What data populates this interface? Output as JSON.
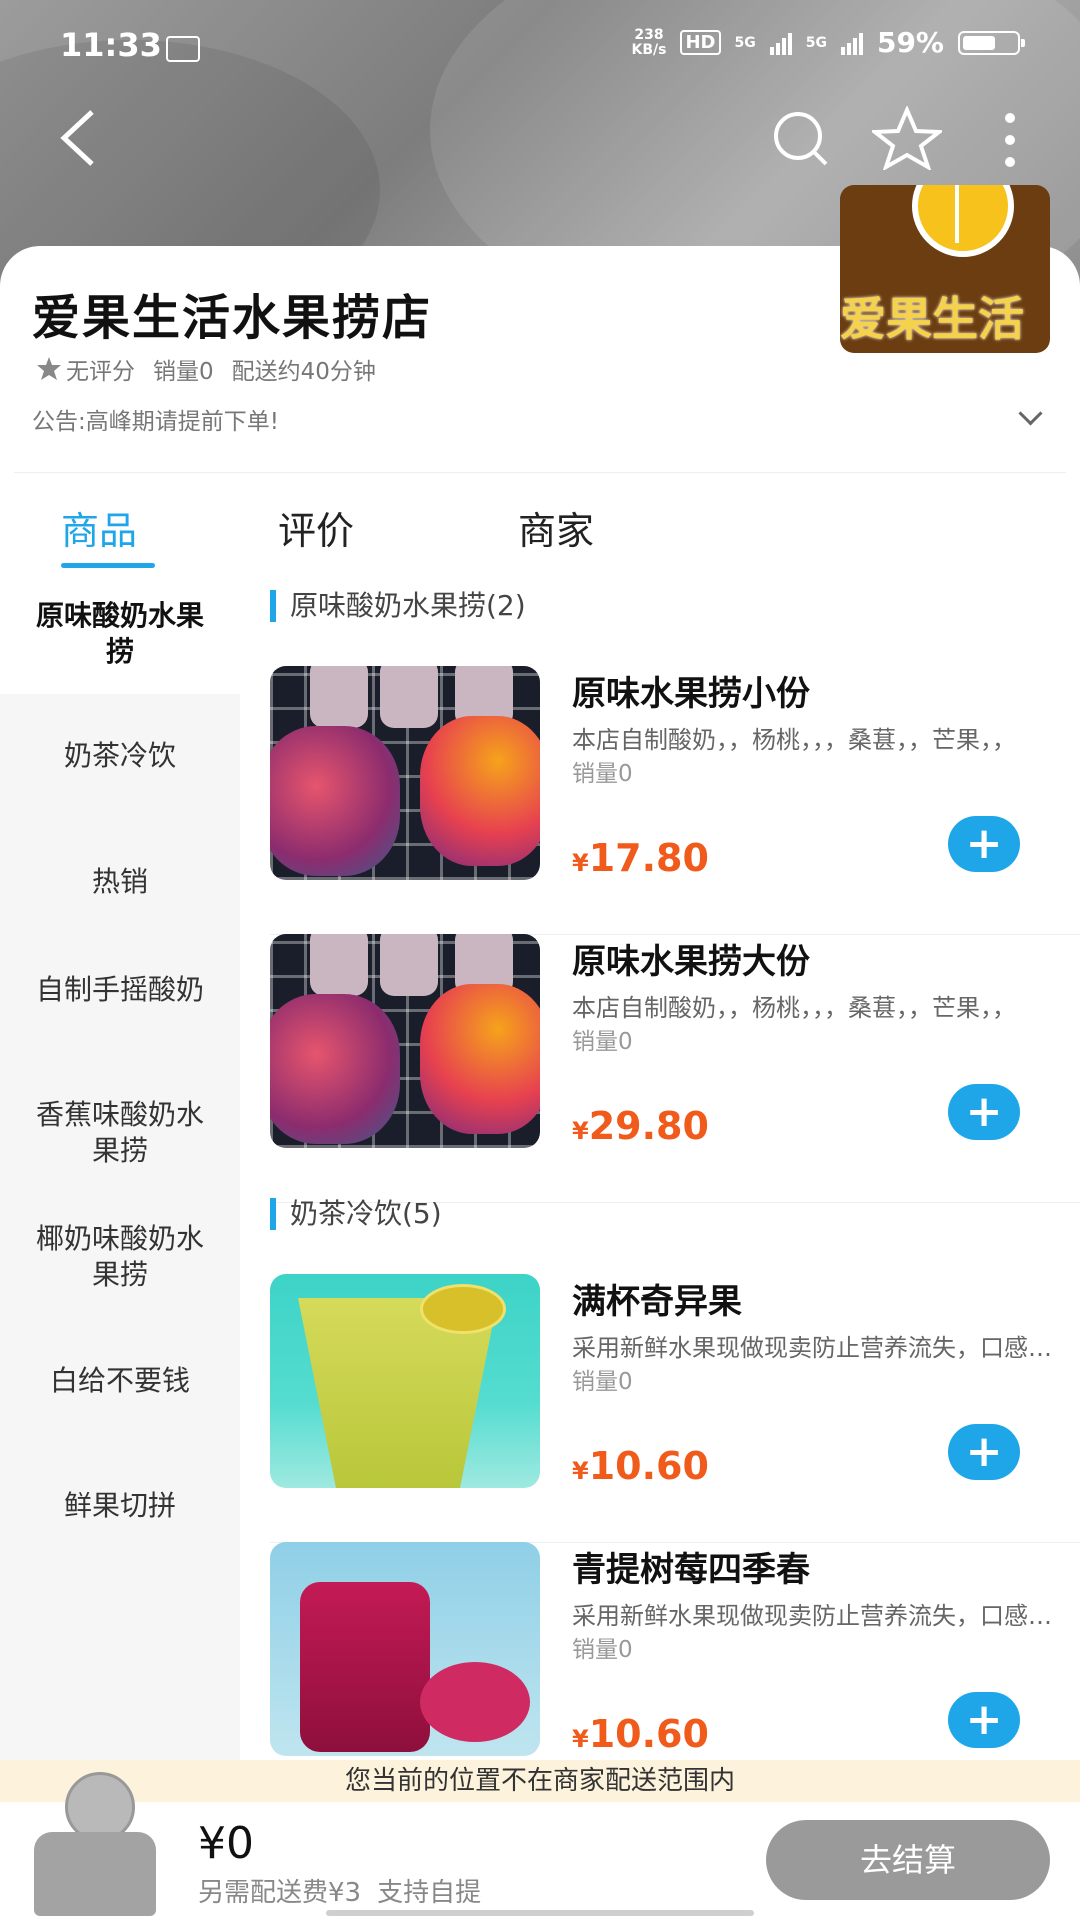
{
  "status_bar": {
    "time": "11:33",
    "speed": "238",
    "speed_unit": "KB/s",
    "hd": "HD",
    "net1": "5G",
    "net2": "5G",
    "battery": "59%",
    "battery_level": 0.59
  },
  "nav": {
    "back_icon": "back-arrow-icon",
    "search_icon": "search-icon",
    "favorite_icon": "star-icon",
    "more_icon": "more-vertical-icon"
  },
  "shop": {
    "logo_text": "爱果生活",
    "name": "爱果生活水果捞店",
    "rating": "无评分",
    "sales": "销量0",
    "delivery": "配送约40分钟",
    "notice": "公告:高峰期请提前下单!"
  },
  "tabs": [
    {
      "label": "商品"
    },
    {
      "label": "评价"
    },
    {
      "label": "商家"
    }
  ],
  "sidebar": [
    {
      "label": "原味酸奶水果捞"
    },
    {
      "label": "奶茶冷饮"
    },
    {
      "label": "热销"
    },
    {
      "label": "自制手摇酸奶"
    },
    {
      "label": "香蕉味酸奶水果捞"
    },
    {
      "label": "椰奶味酸奶水果捞"
    },
    {
      "label": "白给不要钱"
    },
    {
      "label": "鲜果切拼"
    }
  ],
  "sections": [
    {
      "title": "原味酸奶水果捞(2)"
    },
    {
      "title": "奶茶冷饮(5)"
    }
  ],
  "products": [
    {
      "name": "原味水果捞小份",
      "desc": "本店自制酸奶，，杨桃，，，桑葚，，芒果，，",
      "sales": "销量0",
      "currency": "¥",
      "price": "17.80"
    },
    {
      "name": "原味水果捞大份",
      "desc": "本店自制酸奶，，杨桃，，，桑葚，，芒果，，",
      "sales": "销量0",
      "currency": "¥",
      "price": "29.80"
    },
    {
      "name": "满杯奇异果",
      "desc": "采用新鲜水果现做现卖防止营养流失，口感清爽",
      "sales": "销量0",
      "currency": "¥",
      "price": "10.60"
    },
    {
      "name": "青提树莓四季春",
      "desc": "采用新鲜水果现做现卖防止营养流失，口感清爽",
      "sales": "销量0",
      "currency": "¥",
      "price": "10.60"
    }
  ],
  "add_label": "+",
  "delivery_notice": "您当前的位置不在商家配送范围内",
  "cart": {
    "total": "¥0",
    "extra_fee": "另需配送费¥3",
    "pickup": "支持自提",
    "checkout": "去结算"
  }
}
